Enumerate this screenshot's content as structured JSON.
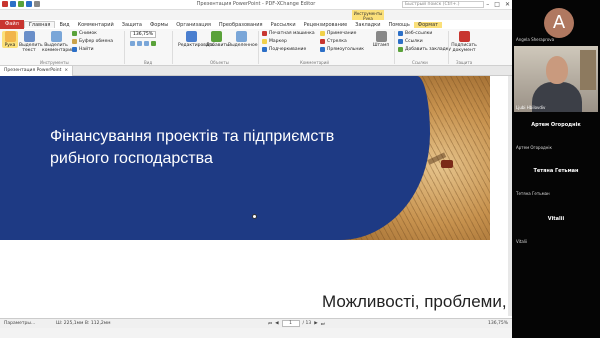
{
  "window": {
    "title": "Презентация PowerPoint - PDF-XChange Editor",
    "search_placeholder": "Быстрый поиск (Ctrl+.)",
    "minimize": "–",
    "maximize": "□",
    "close": "✕",
    "context_badge": "Инструменты Рука",
    "qat_colors": [
      "#c8352f",
      "#2c6fc7",
      "#5aa23a",
      "#2c6fc7",
      "#888888"
    ]
  },
  "ribbon_tabs": {
    "file": "Файл",
    "tabs": [
      "Главная",
      "Вид",
      "Комментарий",
      "Защита",
      "Формы",
      "Организация",
      "Преобразования",
      "Рассылки",
      "Рецензирование",
      "Закладки",
      "Помощь",
      "Формат"
    ],
    "active": "Главная"
  },
  "ribbon": {
    "hand": "Рука",
    "select_text": "Выделить текст",
    "select_comments": "Выделить комментарии",
    "snapshot": "Снимок",
    "clipboard": "Буфер обмена",
    "find": "Найти",
    "zoom_value": "136,75%",
    "edit": "Редактировать",
    "add": "Добавить",
    "select": "Выделенное",
    "typewriter": "Печатная машинка",
    "marker": "Маркер",
    "underline": "Подчеркивание",
    "note": "Примечание",
    "arrow": "Стрелка",
    "rectangle": "Прямоугольник",
    "stamp": "Штамп",
    "web_links": "Веб-ссылки",
    "links": "Ссылки",
    "add_bookmark": "Добавить закладку",
    "sign": "Подписать документ",
    "groups": [
      "Инструменты",
      "Вид",
      "Объекты",
      "Комментарий",
      "Ссылки",
      "Защита"
    ]
  },
  "document_tab": {
    "name": "Презентация PowerPoint",
    "close": "×"
  },
  "slide": {
    "title": "Фінансування проектів та підприємств рибного господарства"
  },
  "next_slide": {
    "text": "Можливості, проблеми,"
  },
  "statusbar": {
    "options": "Параметры...",
    "coords": "Ш: 225,1мм  В: 112,2мм",
    "page_current": "1",
    "page_total": "/ 13",
    "zoom": "136,75%"
  },
  "video_call": {
    "top_participant_initial": "A",
    "top_participant_name": "Angela Sheraprova",
    "camera_name": "Ljubi Hbilovdiv",
    "participants": [
      {
        "display": "Артем Огороднік",
        "label": "Артем Огороднік"
      },
      {
        "display": "Тетяна Гетьман",
        "label": "Тетяна Гетьман"
      },
      {
        "display": "Vitalii",
        "label": "Vitalii"
      }
    ]
  }
}
